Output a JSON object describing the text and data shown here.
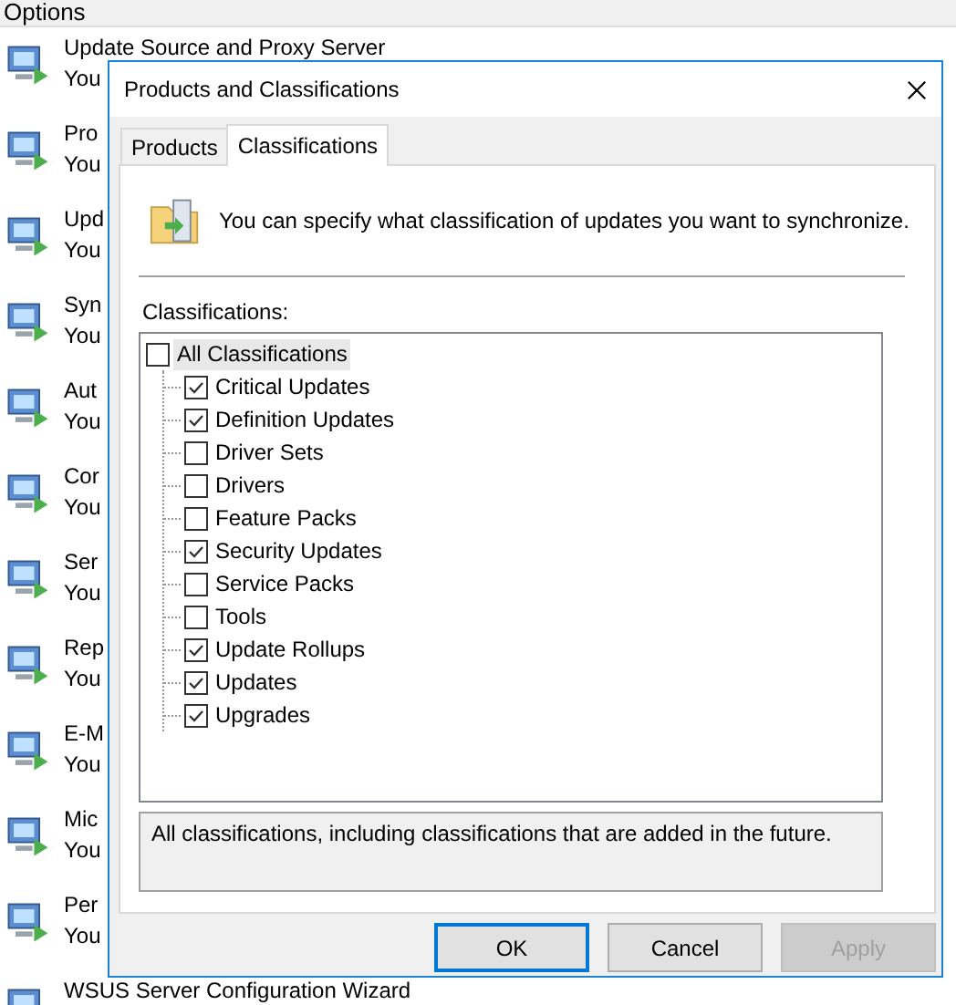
{
  "window": {
    "title": "Options"
  },
  "options_items": [
    {
      "title": "Update Source and Proxy Server",
      "subtitle": "You"
    },
    {
      "title": "Pro",
      "subtitle": "You"
    },
    {
      "title": "Upd",
      "subtitle": "You"
    },
    {
      "title": "Syn",
      "subtitle": "You"
    },
    {
      "title": "Aut",
      "subtitle": "You"
    },
    {
      "title": "Cor",
      "subtitle": "You"
    },
    {
      "title": "Ser",
      "subtitle": "You"
    },
    {
      "title": "Rep",
      "subtitle": "You"
    },
    {
      "title": "E-M",
      "subtitle": "You"
    },
    {
      "title": "Mic",
      "subtitle": "You"
    },
    {
      "title": "Per",
      "subtitle": "You"
    },
    {
      "title": "WSUS Server Configuration Wizard"
    }
  ],
  "dialog": {
    "title": "Products and Classifications",
    "tabs": [
      {
        "label": "Products",
        "selected": false
      },
      {
        "label": "Classifications",
        "selected": true
      }
    ],
    "intro": "You can specify what classification of updates you want to synchronize.",
    "tree_label": "Classifications:",
    "tree": [
      {
        "label": "All Classifications",
        "checked": false,
        "selected": true,
        "children": [
          {
            "label": "Critical Updates",
            "checked": true
          },
          {
            "label": "Definition Updates",
            "checked": true
          },
          {
            "label": "Driver Sets",
            "checked": false
          },
          {
            "label": "Drivers",
            "checked": false
          },
          {
            "label": "Feature Packs",
            "checked": false
          },
          {
            "label": "Security Updates",
            "checked": true
          },
          {
            "label": "Service Packs",
            "checked": false
          },
          {
            "label": "Tools",
            "checked": false
          },
          {
            "label": "Update Rollups",
            "checked": true
          },
          {
            "label": "Updates",
            "checked": true
          },
          {
            "label": "Upgrades",
            "checked": true
          }
        ]
      }
    ],
    "description": "All classifications, including classifications that are added in the future.",
    "buttons": [
      {
        "label": "OK",
        "disabled": false,
        "default": true
      },
      {
        "label": "Cancel",
        "disabled": false,
        "default": false
      },
      {
        "label": "Apply",
        "disabled": true,
        "default": false
      }
    ]
  }
}
